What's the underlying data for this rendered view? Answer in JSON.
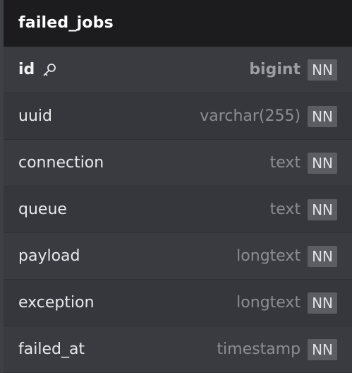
{
  "table": {
    "name": "failed_jobs",
    "columns": [
      {
        "name": "id",
        "type": "bigint",
        "constraint": "NN",
        "primary_key": true,
        "icon": "key-icon"
      },
      {
        "name": "uuid",
        "type": "varchar(255)",
        "constraint": "NN",
        "primary_key": false
      },
      {
        "name": "connection",
        "type": "text",
        "constraint": "NN",
        "primary_key": false
      },
      {
        "name": "queue",
        "type": "text",
        "constraint": "NN",
        "primary_key": false
      },
      {
        "name": "payload",
        "type": "longtext",
        "constraint": "NN",
        "primary_key": false
      },
      {
        "name": "exception",
        "type": "longtext",
        "constraint": "NN",
        "primary_key": false
      },
      {
        "name": "failed_at",
        "type": "timestamp",
        "constraint": "NN",
        "primary_key": false
      }
    ]
  },
  "colors": {
    "header_bg": "#1c1c1e",
    "body_bg": "#38393f",
    "name_text": "#e9e9ea",
    "type_text": "#8d8e93",
    "badge_bg": "#5c5d63"
  }
}
